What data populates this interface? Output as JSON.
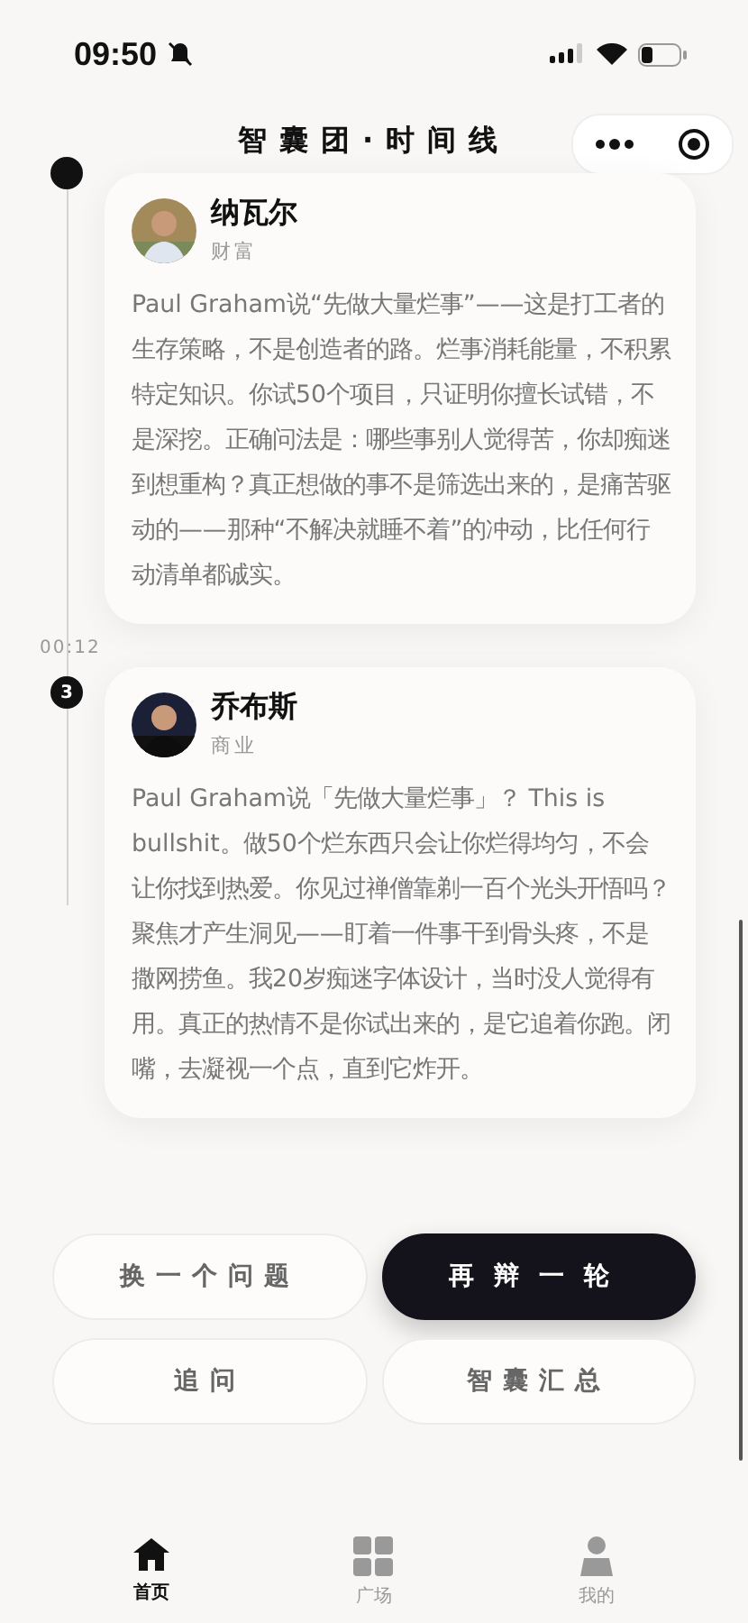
{
  "status_bar": {
    "time": "09:50"
  },
  "nav": {
    "title": "智囊团·时间线"
  },
  "timeline": [
    {
      "name": "纳瓦尔",
      "tag": "财富",
      "text": "Paul Graham说“先做大量烂事”——这是打工者的生存策略，不是创造者的路。烂事消耗能量，不积累特定知识。你试50个项目，只证明你擅长试错，不是深挖。正确问法是：哪些事别人觉得苦，你却痴迷到想重构？真正想做的事不是筛选出来的，是痛苦驱动的——那种“不解决就睡不着”的冲动，比任何行动清单都诚实。"
    },
    {
      "time": "00:12",
      "node": "3",
      "name": "乔布斯",
      "tag": "商业",
      "text": "Paul Graham说「先做大量烂事」？ This is bullshit。做50个烂东西只会让你烂得均匀，不会让你找到热爱。你见过禅僧靠剃一百个光头开悟吗？聚焦才产生洞见——盯着一件事干到骨头疼，不是撒网捞鱼。我20岁痴迷字体设计，当时没人觉得有用。真正的热情不是你试出来的，是它追着你跑。闭嘴，去凝视一个点，直到它炸开。"
    }
  ],
  "actions": [
    {
      "label": "换一个问题",
      "kind": "secondary"
    },
    {
      "label": "再辩一轮",
      "kind": "primary"
    },
    {
      "label": "追问",
      "kind": "secondary"
    },
    {
      "label": "智囊汇总",
      "kind": "secondary"
    }
  ],
  "tab_bar": [
    {
      "label": "首页",
      "kind": "home",
      "selected": true
    },
    {
      "label": "广场",
      "kind": "grid",
      "selected": false
    },
    {
      "label": "我的",
      "kind": "person",
      "selected": false
    }
  ]
}
